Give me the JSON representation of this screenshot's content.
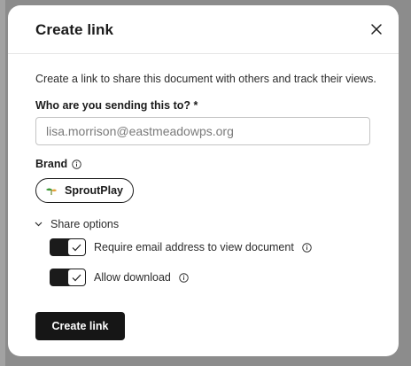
{
  "dialog": {
    "title": "Create link",
    "description": "Create a link to share this document with others and track their views.",
    "recipient_label": "Who are you sending this to? *",
    "recipient_placeholder": "lisa.morrison@eastmeadowps.org",
    "brand_label": "Brand",
    "brand_name": "SproutPlay",
    "share_options_label": "Share options",
    "options": [
      {
        "label": "Require email address to view document",
        "enabled": true
      },
      {
        "label": "Allow download",
        "enabled": true
      }
    ],
    "submit_label": "Create link"
  },
  "icons": {
    "close": "close-icon",
    "info": "info-icon",
    "chevron": "chevron-down-icon",
    "check": "check-icon",
    "brand_logo": "sproutplay-logo-icon"
  },
  "colors": {
    "primary": "#161616",
    "toggle_on": "#1b1b1b",
    "backdrop": "#8c8c8c"
  }
}
